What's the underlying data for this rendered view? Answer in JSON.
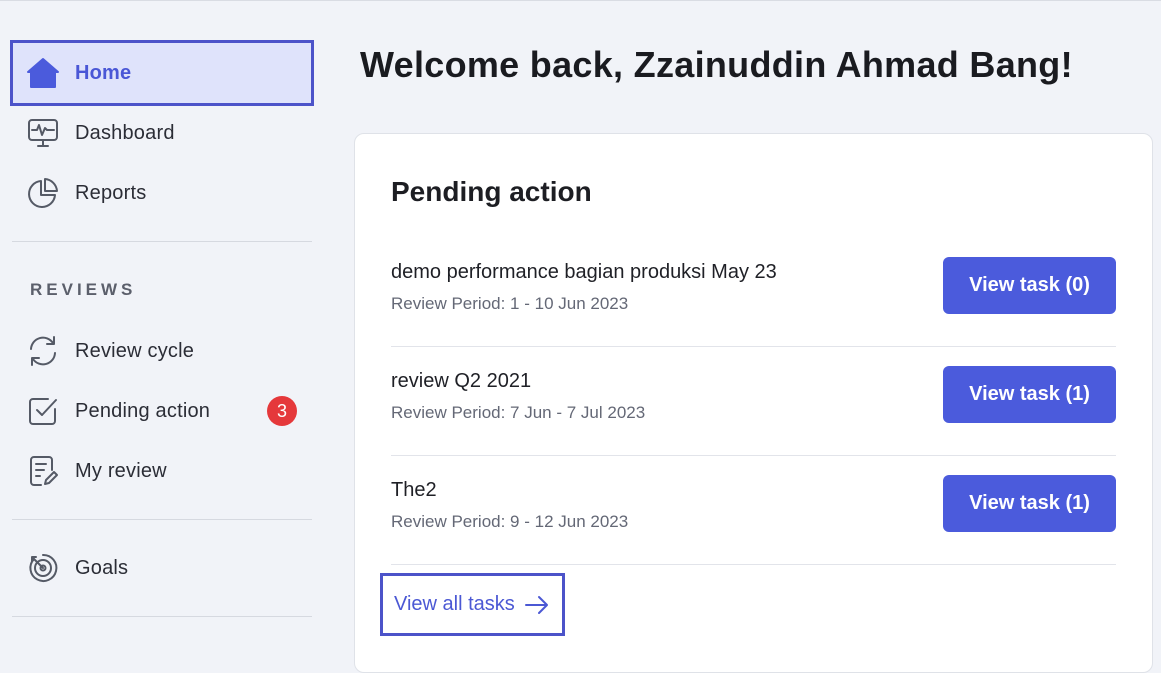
{
  "colors": {
    "accent": "#4b5bdc",
    "active_bg": "#dfe3fb",
    "badge": "#e5383b",
    "page_bg": "#f1f3f8"
  },
  "sidebar": {
    "items": [
      {
        "label": "Home",
        "icon": "home-icon",
        "active": true
      },
      {
        "label": "Dashboard",
        "icon": "monitor-pulse-icon"
      },
      {
        "label": "Reports",
        "icon": "pie-chart-icon"
      }
    ],
    "reviews_title": "REVIEWS",
    "reviews_items": [
      {
        "label": "Review cycle",
        "icon": "refresh-icon"
      },
      {
        "label": "Pending action",
        "icon": "checkbox-icon",
        "badge": "3"
      },
      {
        "label": "My review",
        "icon": "document-edit-icon"
      }
    ],
    "goals_item": {
      "label": "Goals",
      "icon": "target-icon"
    }
  },
  "main": {
    "title": "Welcome back, Zzainuddin Ahmad Bang!",
    "card": {
      "title": "Pending action",
      "tasks": [
        {
          "name": "demo performance bagian produksi May 23",
          "period": "Review Period: 1 - 10 Jun 2023",
          "button": "View task (0)"
        },
        {
          "name": "review Q2 2021",
          "period": "Review Period: 7 Jun - 7 Jul 2023",
          "button": "View task (1)"
        },
        {
          "name": "The2",
          "period": "Review Period: 9 - 12 Jun 2023",
          "button": "View task (1)"
        }
      ],
      "view_all_label": "View all tasks"
    }
  }
}
